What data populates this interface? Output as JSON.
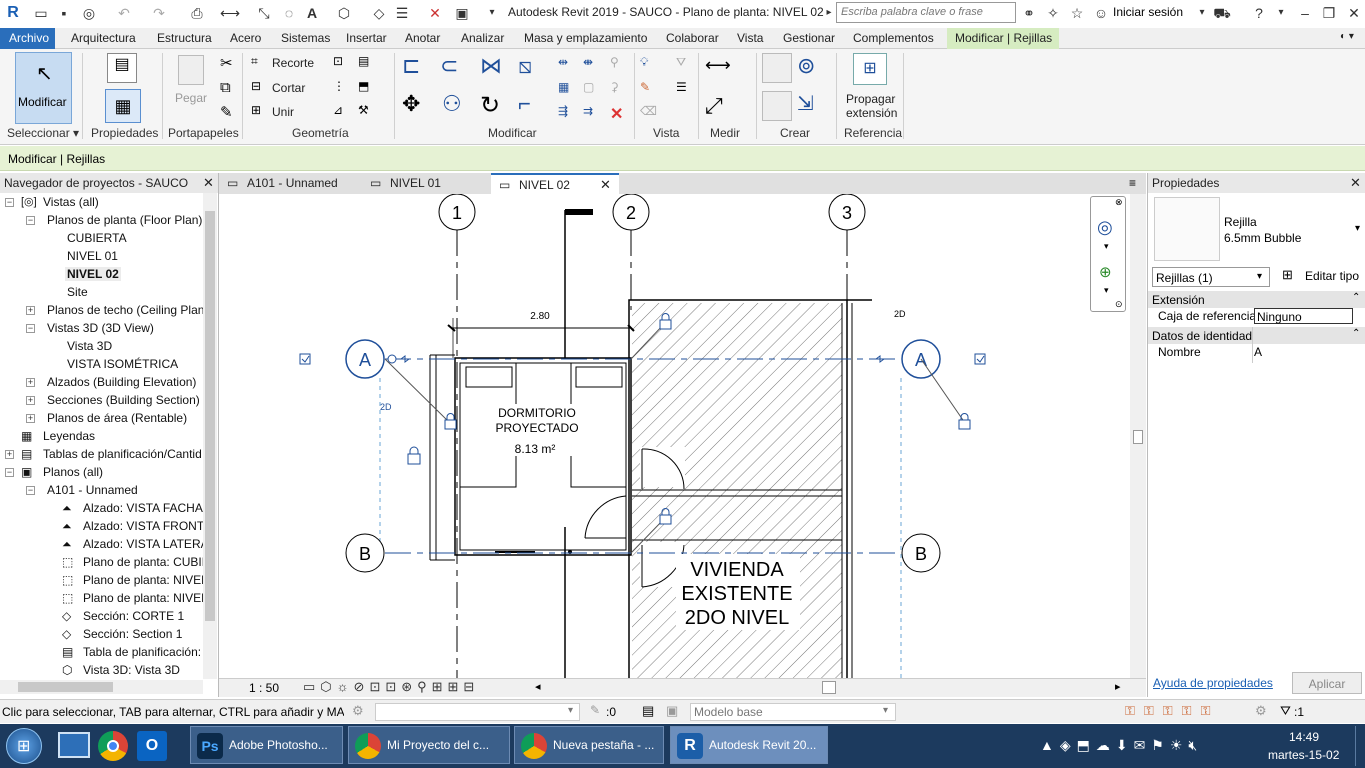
{
  "app": {
    "title": "Autodesk Revit 2019 - SAUCO - Plano de planta: NIVEL 02",
    "search_placeholder": "Escriba palabra clave o frase",
    "signin": "Iniciar sesión"
  },
  "menu": [
    "Archivo",
    "Arquitectura",
    "Estructura",
    "Acero",
    "Sistemas",
    "Insertar",
    "Anotar",
    "Analizar",
    "Masa y emplazamiento",
    "Colaborar",
    "Vista",
    "Gestionar",
    "Complementos",
    "Modificar | Rejillas"
  ],
  "ribbon": {
    "modificar": "Modificar",
    "pegar": "Pegar",
    "recorte": "Recorte",
    "cortar": "Cortar",
    "unir": "Unir",
    "propagar_1": "Propagar",
    "propagar_2": "extensión",
    "groups": [
      "Seleccionar ▾",
      "Propiedades",
      "Portapapeles",
      "Geometría",
      "Modificar",
      "Vista",
      "Medir",
      "Crear",
      "Referencia"
    ]
  },
  "context_bar": "Modificar | Rejillas",
  "browser": {
    "title": "Navegador de proyectos - SAUCO",
    "items": [
      "Vistas (all)",
      "Planos de planta (Floor Plan)",
      "CUBIERTA",
      "NIVEL 01",
      "NIVEL 02",
      "Site",
      "Planos de techo (Ceiling Plan",
      "Vistas 3D (3D View)",
      "Vista 3D",
      "VISTA ISOMÉTRICA",
      "Alzados (Building Elevation)",
      "Secciones (Building Section)",
      "Planos de área (Rentable)",
      "Leyendas",
      "Tablas de planificación/Cantid",
      "Planos (all)",
      "A101 - Unnamed",
      "Alzado: VISTA FACHAD",
      "Alzado: VISTA FRONTA",
      "Alzado: VISTA LATERAI",
      "Plano de planta: CUBIE",
      "Plano de planta: NIVEL",
      "Plano de planta: NIVEL",
      "Sección: CORTE 1",
      "Sección: Section 1",
      "Tabla de planificación:",
      "Vista 3D: Vista 3D"
    ]
  },
  "tabs": [
    "A101 - Unnamed",
    "NIVEL 01",
    "NIVEL 02"
  ],
  "drawing": {
    "grid_cols": [
      "1",
      "2",
      "3"
    ],
    "grid_rows": [
      "A",
      "B"
    ],
    "dim": "2.80",
    "room_name_1": "DORMITORIO",
    "room_name_2": "PROYECTADO",
    "room_area": "8.13 m²",
    "existing_1": "VIVIENDA",
    "existing_2": "EXISTENTE",
    "existing_3": "2DO NIVEL",
    "tag_2d": "2D"
  },
  "viewbar": {
    "scale": "1 : 50"
  },
  "properties": {
    "title": "Propiedades",
    "type_name": "Rejilla",
    "type_sub": "6.5mm Bubble",
    "selector": "Rejillas (1)",
    "edit_type": "Editar tipo",
    "section_ext": "Extensión",
    "ref_label": "Caja de referencia",
    "ref_value": "Ninguno",
    "section_id": "Datos de identidad",
    "name_label": "Nombre",
    "name_value": "A",
    "help": "Ayuda de propiedades",
    "apply": "Aplicar"
  },
  "status": {
    "hint": "Clic para seleccionar, TAB para alternar, CTRL para añadir y MAYÚ",
    "zero": ":0",
    "model": "Modelo base",
    "filter": ":1"
  },
  "taskbar": {
    "items": [
      "Adobe Photosho...",
      "Mi Proyecto del c...",
      "Nueva pestaña - ...",
      "Autodesk Revit 20..."
    ],
    "time": "14:49",
    "date": "martes-15-02"
  },
  "colors": {
    "accent": "#2a6ebb",
    "context": "#d6ecc1",
    "grid": "#1f4f9a"
  }
}
